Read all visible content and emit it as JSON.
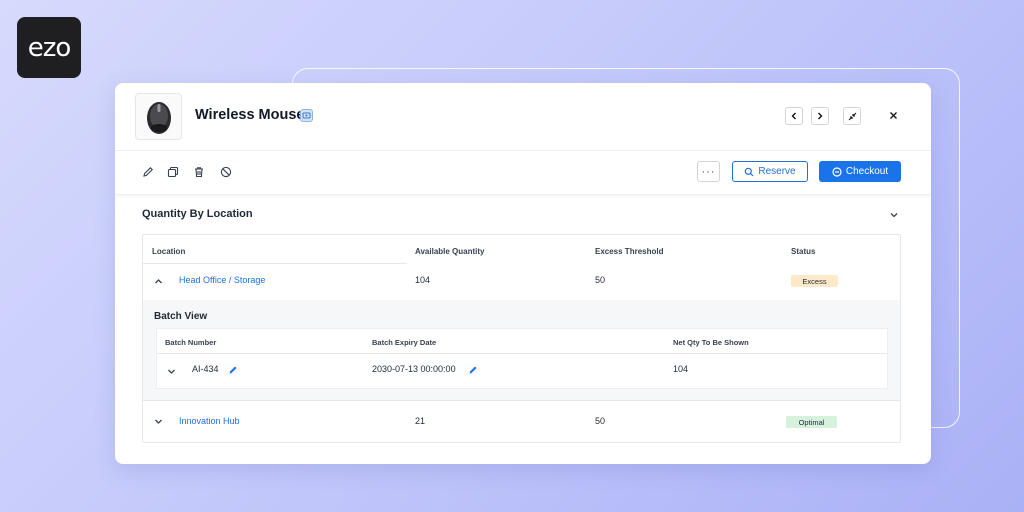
{
  "brand": {
    "logo_text": "ezo"
  },
  "item": {
    "title": "Wireless Mouse",
    "thumbnail_icon": "mouse-icon"
  },
  "header_controls": {
    "prev_icon": "chevron-left-icon",
    "next_icon": "chevron-right-icon",
    "collapse_icon": "collapse-icon",
    "close_icon": "close-icon"
  },
  "toolbar": {
    "edit_icon": "pencil-icon",
    "copy_icon": "copy-icon",
    "delete_icon": "trash-icon",
    "disable_icon": "ban-icon",
    "more_label": "···",
    "reserve_label": "Reserve",
    "checkout_label": "Checkout"
  },
  "section": {
    "title": "Quantity By Location"
  },
  "table": {
    "headers": [
      "Location",
      "Available Quantity",
      "Excess Threshold",
      "Status"
    ],
    "rows": [
      {
        "location": "Head Office / Storage",
        "available": "104",
        "threshold": "50",
        "status": "Excess",
        "status_color": "#fde8c8",
        "expanded": true
      },
      {
        "location": "Innovation Hub",
        "available": "21",
        "threshold": "50",
        "status": "Optimal",
        "status_color": "#d6f2dd",
        "expanded": false
      }
    ]
  },
  "batch_view": {
    "title": "Batch View",
    "headers": [
      "Batch Number",
      "Batch Expiry Date",
      "Net Qty To Be Shown"
    ],
    "rows": [
      {
        "batch_number": "AI-434",
        "expiry": "2030-07-13 00:00:00",
        "net_qty": "104"
      }
    ]
  },
  "colors": {
    "accent": "#1a73e8",
    "excess": "#fde8c8",
    "optimal": "#d6f2dd"
  }
}
